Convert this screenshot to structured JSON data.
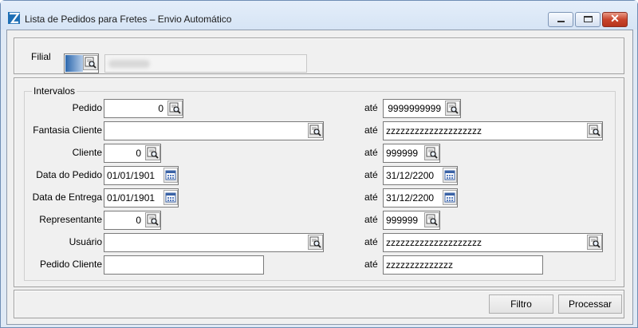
{
  "window": {
    "title": "Lista de Pedidos para Fretes – Envio Automático",
    "controls": {
      "close_glyph": "✕"
    }
  },
  "filial": {
    "label": "Filial"
  },
  "intervalos": {
    "group_label": "Intervalos",
    "ate_label": "até",
    "rows": [
      {
        "label": "Pedido",
        "from": "0",
        "to": "9999999999"
      },
      {
        "label": "Fantasia Cliente",
        "from": "",
        "to": "zzzzzzzzzzzzzzzzzzzz"
      },
      {
        "label": "Cliente",
        "from": "0",
        "to": "999999"
      },
      {
        "label": "Data do Pedido",
        "from": "01/01/1901",
        "to": "31/12/2200"
      },
      {
        "label": "Data de Entrega",
        "from": "01/01/1901",
        "to": "31/12/2200"
      },
      {
        "label": "Representante",
        "from": "0",
        "to": "999999"
      },
      {
        "label": "Usuário",
        "from": "",
        "to": "zzzzzzzzzzzzzzzzzzzz"
      },
      {
        "label": "Pedido Cliente",
        "from": "",
        "to": "zzzzzzzzzzzzzz"
      }
    ]
  },
  "actions": {
    "filtro": "Filtro",
    "processar": "Processar"
  },
  "colors": {
    "accent": "#2c67ad",
    "close_red": "#c9452d",
    "window_frame": "#dfe9f5"
  },
  "icons": [
    "app-icon",
    "minimize-icon",
    "maximize-icon",
    "close-icon",
    "lookup-icon",
    "calendar-icon"
  ]
}
